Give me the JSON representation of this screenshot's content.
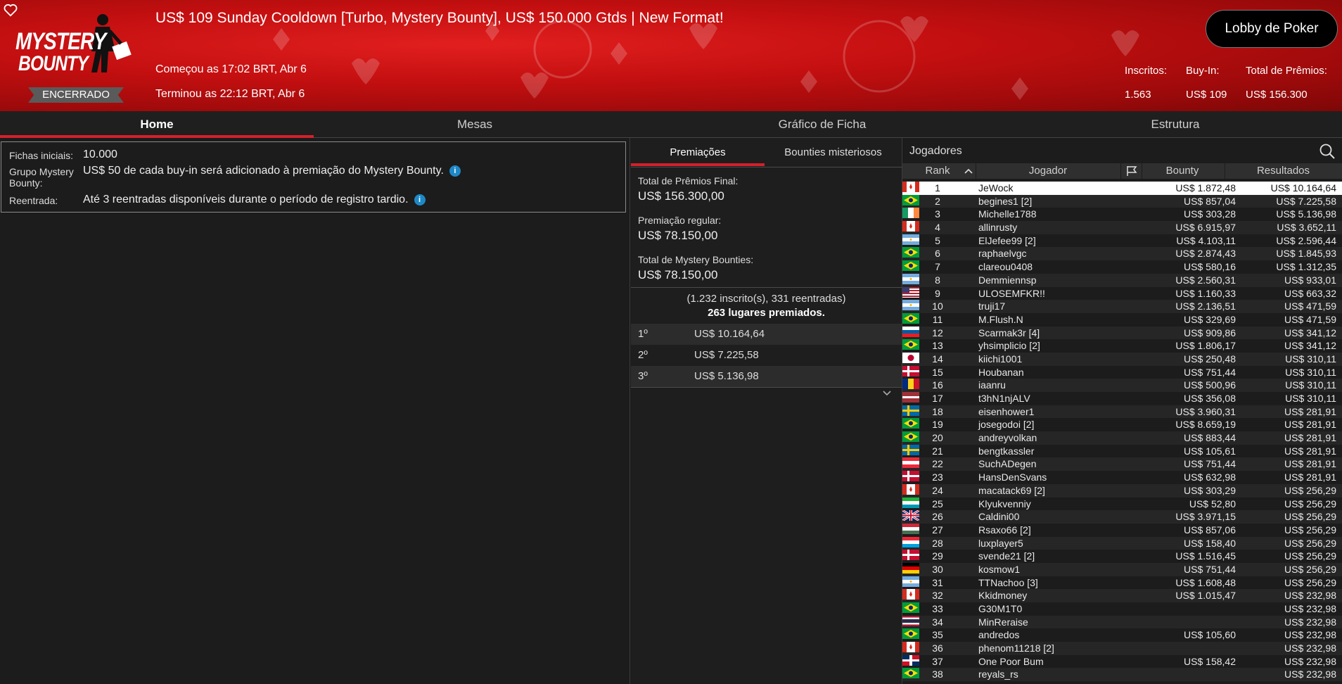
{
  "header": {
    "title": "US$ 109 Sunday Cooldown [Turbo, Mystery Bounty], US$ 150.000 Gtds | New Format!",
    "logo_line1": "MYSTERY",
    "logo_line2": "BOUNTY",
    "status": "ENCERRADO",
    "started": "Começou as 17:02 BRT, Abr 6",
    "ended": "Terminou as 22:12 BRT, Abr 6",
    "lobby_button": "Lobby de Poker",
    "stats": {
      "entrants_label": "Inscritos:",
      "entrants_value": "1.563",
      "buyin_label": "Buy-In:",
      "buyin_value": "US$ 109",
      "prize_label": "Total de Prêmios:",
      "prize_value": "US$ 156.300"
    }
  },
  "tabs": [
    "Home",
    "Mesas",
    "Gráfico de Ficha",
    "Estrutura"
  ],
  "info": {
    "chips_label": "Fichas iniciais:",
    "chips_value": "10.000",
    "group_label_1": "Grupo Mystery",
    "group_label_2": "Bounty:",
    "group_value": "US$ 50 de cada buy-in será adicionado à premiação do Mystery Bounty.",
    "reentry_label": "Reentrada:",
    "reentry_value": "Até 3 reentradas disponíveis durante o período de registro tardio."
  },
  "prizes": {
    "tab_prizes": "Premiações",
    "tab_bounties": "Bounties misteriosos",
    "final_label": "Total de Prêmios Final:",
    "final_value": "US$ 156.300,00",
    "regular_label": "Premiação regular:",
    "regular_value": "US$ 78.150,00",
    "mystery_label": "Total de Mystery Bounties:",
    "mystery_value": "US$ 78.150,00",
    "entries_text": "(1.232 inscrito(s), 331 reentradas)",
    "places_text": "263 lugares premiados.",
    "payouts": [
      {
        "place": "1º",
        "value": "US$ 10.164,64"
      },
      {
        "place": "2º",
        "value": "US$ 7.225,58"
      },
      {
        "place": "3º",
        "value": "US$ 5.136,98"
      }
    ]
  },
  "players": {
    "title": "Jogadores",
    "columns": {
      "rank": "Rank",
      "player": "Jogador",
      "bounty": "Bounty",
      "results": "Resultados"
    },
    "rows": [
      {
        "rank": "1",
        "name": "JeWock",
        "flag": "CA",
        "bounty": "US$ 1.872,48",
        "result": "US$ 10.164,64"
      },
      {
        "rank": "2",
        "name": "begines1 [2]",
        "flag": "BR",
        "bounty": "US$ 857,04",
        "result": "US$ 7.225,58"
      },
      {
        "rank": "3",
        "name": "Michelle1788",
        "flag": "IE",
        "bounty": "US$ 303,28",
        "result": "US$ 5.136,98"
      },
      {
        "rank": "4",
        "name": "allinrusty",
        "flag": "CA",
        "bounty": "US$ 6.915,97",
        "result": "US$ 3.652,11"
      },
      {
        "rank": "5",
        "name": "ElJefee99 [2]",
        "flag": "AR",
        "bounty": "US$ 4.103,11",
        "result": "US$ 2.596,44"
      },
      {
        "rank": "6",
        "name": "raphaelvgc",
        "flag": "BR",
        "bounty": "US$ 2.874,43",
        "result": "US$ 1.845,93"
      },
      {
        "rank": "7",
        "name": "clareou0408",
        "flag": "BR",
        "bounty": "US$ 580,16",
        "result": "US$ 1.312,35"
      },
      {
        "rank": "8",
        "name": "Demmiennsp",
        "flag": "AR",
        "bounty": "US$ 2.560,31",
        "result": "US$ 933,01"
      },
      {
        "rank": "9",
        "name": "ULOSEMFKR!!",
        "flag": "US",
        "bounty": "US$ 1.160,33",
        "result": "US$ 663,32"
      },
      {
        "rank": "10",
        "name": "truji17",
        "flag": "AR",
        "bounty": "US$ 2.136,51",
        "result": "US$ 471,59"
      },
      {
        "rank": "11",
        "name": "M.Flush.N",
        "flag": "BR",
        "bounty": "US$ 329,69",
        "result": "US$ 471,59"
      },
      {
        "rank": "12",
        "name": "Scarmak3r [4]",
        "flag": "SI",
        "bounty": "US$ 909,86",
        "result": "US$ 341,12"
      },
      {
        "rank": "13",
        "name": "yhsimplicio [2]",
        "flag": "BR",
        "bounty": "US$ 1.806,17",
        "result": "US$ 341,12"
      },
      {
        "rank": "14",
        "name": "kiichi1001",
        "flag": "JP",
        "bounty": "US$ 250,48",
        "result": "US$ 310,11"
      },
      {
        "rank": "15",
        "name": "Houbanan",
        "flag": "DK",
        "bounty": "US$ 751,44",
        "result": "US$ 310,11"
      },
      {
        "rank": "16",
        "name": "iaanru",
        "flag": "RO",
        "bounty": "US$ 500,96",
        "result": "US$ 310,11"
      },
      {
        "rank": "17",
        "name": "t3hN1njALV",
        "flag": "LV",
        "bounty": "US$ 356,08",
        "result": "US$ 310,11"
      },
      {
        "rank": "18",
        "name": "eisenhower1",
        "flag": "SE",
        "bounty": "US$ 3.960,31",
        "result": "US$ 281,91"
      },
      {
        "rank": "19",
        "name": "josegodoi [2]",
        "flag": "BR",
        "bounty": "US$ 8.659,19",
        "result": "US$ 281,91"
      },
      {
        "rank": "20",
        "name": "andreyvolkan",
        "flag": "BR",
        "bounty": "US$ 883,44",
        "result": "US$ 281,91"
      },
      {
        "rank": "21",
        "name": "bengtkassler",
        "flag": "SE",
        "bounty": "US$ 105,61",
        "result": "US$ 281,91"
      },
      {
        "rank": "22",
        "name": "SuchADegen",
        "flag": "AT",
        "bounty": "US$ 751,44",
        "result": "US$ 281,91"
      },
      {
        "rank": "23",
        "name": "HansDenSvans",
        "flag": "DK",
        "bounty": "US$ 632,98",
        "result": "US$ 281,91"
      },
      {
        "rank": "24",
        "name": "macatack69 [2]",
        "flag": "CA",
        "bounty": "US$ 303,29",
        "result": "US$ 256,29"
      },
      {
        "rank": "25",
        "name": "Klyukvenniy",
        "flag": "UZ",
        "bounty": "US$ 52,80",
        "result": "US$ 256,29"
      },
      {
        "rank": "26",
        "name": "Caldini00",
        "flag": "GB",
        "bounty": "US$ 3.971,15",
        "result": "US$ 256,29"
      },
      {
        "rank": "27",
        "name": "Rsaxo66 [2]",
        "flag": "HU",
        "bounty": "US$ 857,06",
        "result": "US$ 256,29"
      },
      {
        "rank": "28",
        "name": "luxplayer5",
        "flag": "LU",
        "bounty": "US$ 158,40",
        "result": "US$ 256,29"
      },
      {
        "rank": "29",
        "name": "svende21 [2]",
        "flag": "DK",
        "bounty": "US$ 1.516,45",
        "result": "US$ 256,29"
      },
      {
        "rank": "30",
        "name": "kosmow1",
        "flag": "DE",
        "bounty": "US$ 751,44",
        "result": "US$ 256,29"
      },
      {
        "rank": "31",
        "name": "TTNachoo [3]",
        "flag": "AR",
        "bounty": "US$ 1.608,48",
        "result": "US$ 256,29"
      },
      {
        "rank": "32",
        "name": "Kkidmoney",
        "flag": "CA",
        "bounty": "US$ 1.015,47",
        "result": "US$ 232,98"
      },
      {
        "rank": "33",
        "name": "G30M1T0",
        "flag": "BR",
        "bounty": "",
        "result": "US$ 232,98"
      },
      {
        "rank": "34",
        "name": "MinReraise",
        "flag": "TH",
        "bounty": "",
        "result": "US$ 232,98"
      },
      {
        "rank": "35",
        "name": "andredos",
        "flag": "BR",
        "bounty": "US$ 105,60",
        "result": "US$ 232,98"
      },
      {
        "rank": "36",
        "name": "phenom11218 [2]",
        "flag": "CA",
        "bounty": "",
        "result": "US$ 232,98"
      },
      {
        "rank": "37",
        "name": "One Poor Bum",
        "flag": "DO",
        "bounty": "US$ 158,42",
        "result": "US$ 232,98"
      },
      {
        "rank": "38",
        "name": "reyals_rs",
        "flag": "BR",
        "bounty": "",
        "result": "US$ 232,98"
      }
    ]
  },
  "colors": {
    "header_red": "#c30f10",
    "accent": "#d4202a",
    "info_icon": "#1e88c7"
  },
  "icons": {
    "favorite": "heart-icon",
    "search": "search-icon",
    "flag_column": "flag-icon",
    "sort": "sort-asc-icon",
    "expand": "chevron-down-icon"
  }
}
